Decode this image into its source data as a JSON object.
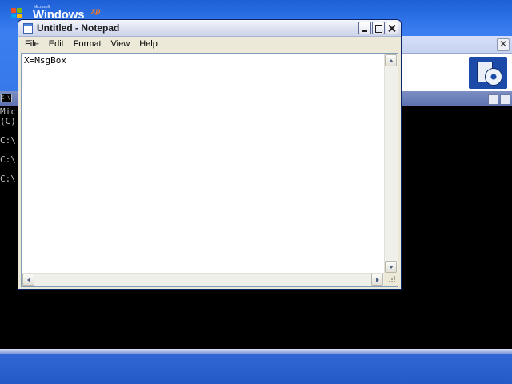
{
  "desktop": {
    "logo": {
      "microsoft": "Microsoft",
      "windows": "Windows",
      "xp": "xp"
    }
  },
  "background_dialog": {
    "close_label": "✕"
  },
  "cmd_window": {
    "icon_text": "C:\\",
    "lines": [
      "Mic",
      "(C)",
      "",
      "C:\\",
      "",
      "C:\\",
      "",
      "C:\\"
    ]
  },
  "notepad": {
    "title": "Untitled - Notepad",
    "menu": [
      "File",
      "Edit",
      "Format",
      "View",
      "Help"
    ],
    "content": "X=MsgBox"
  },
  "colors": {
    "desktop_blue": "#2b6fe4",
    "taskbar_blue": "#2a5fcf",
    "title_bar_light": "#dfe4f2"
  }
}
